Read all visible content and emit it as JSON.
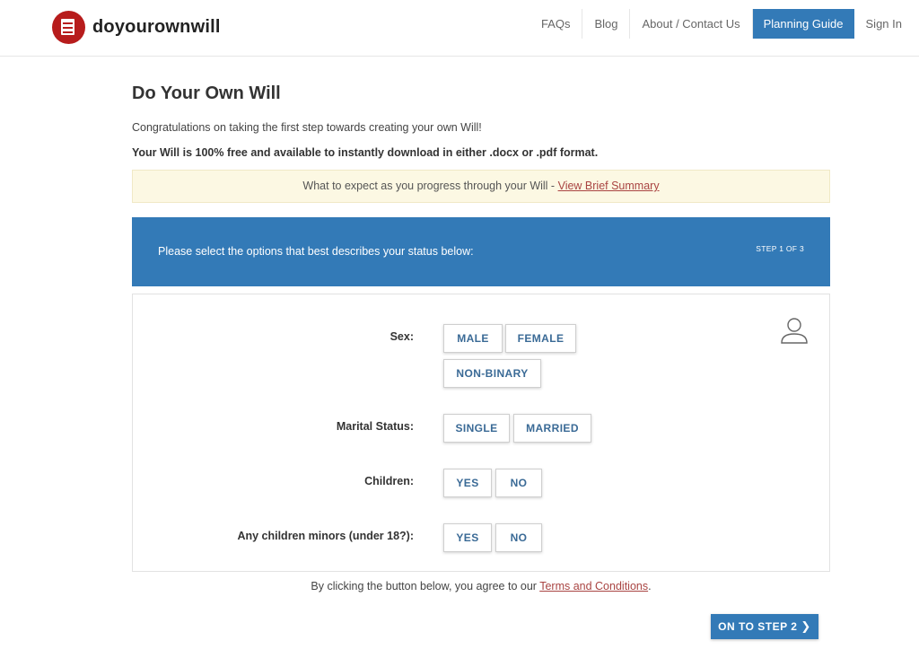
{
  "header": {
    "brand": "doyourownwill",
    "nav": [
      "FAQs",
      "Blog",
      "About / Contact Us",
      "Planning Guide",
      "Sign In"
    ]
  },
  "main": {
    "title": "Do Your Own Will",
    "intro": "Congratulations on taking the first step towards creating your own Will!",
    "intro_bold": "Your Will is 100% free and available to instantly download in either .docx or .pdf format.",
    "notice_text": "What to expect as you progress through your Will - ",
    "notice_link": "View Brief Summary"
  },
  "step": {
    "prompt": "Please select the options that best describes your status below:",
    "count": "STEP 1 OF 3"
  },
  "form": {
    "sex": {
      "label": "Sex:",
      "options": [
        "MALE",
        "FEMALE",
        "NON-BINARY"
      ]
    },
    "marital": {
      "label": "Marital Status:",
      "options": [
        "SINGLE",
        "MARRIED"
      ]
    },
    "children": {
      "label": "Children:",
      "options": [
        "YES",
        "NO"
      ]
    },
    "minors": {
      "label": "Any children minors (under 18?):",
      "options": [
        "YES",
        "NO"
      ]
    }
  },
  "footer": {
    "agree_text": "By clicking the button below, you agree to our ",
    "terms_link": "Terms and Conditions",
    "agree_end": ".",
    "next_button": "ON TO STEP 2"
  },
  "colors": {
    "primary": "#337ab7",
    "brand_red": "#b71c1c",
    "notice_bg": "#fcf8e3",
    "link_red": "#a94442"
  }
}
